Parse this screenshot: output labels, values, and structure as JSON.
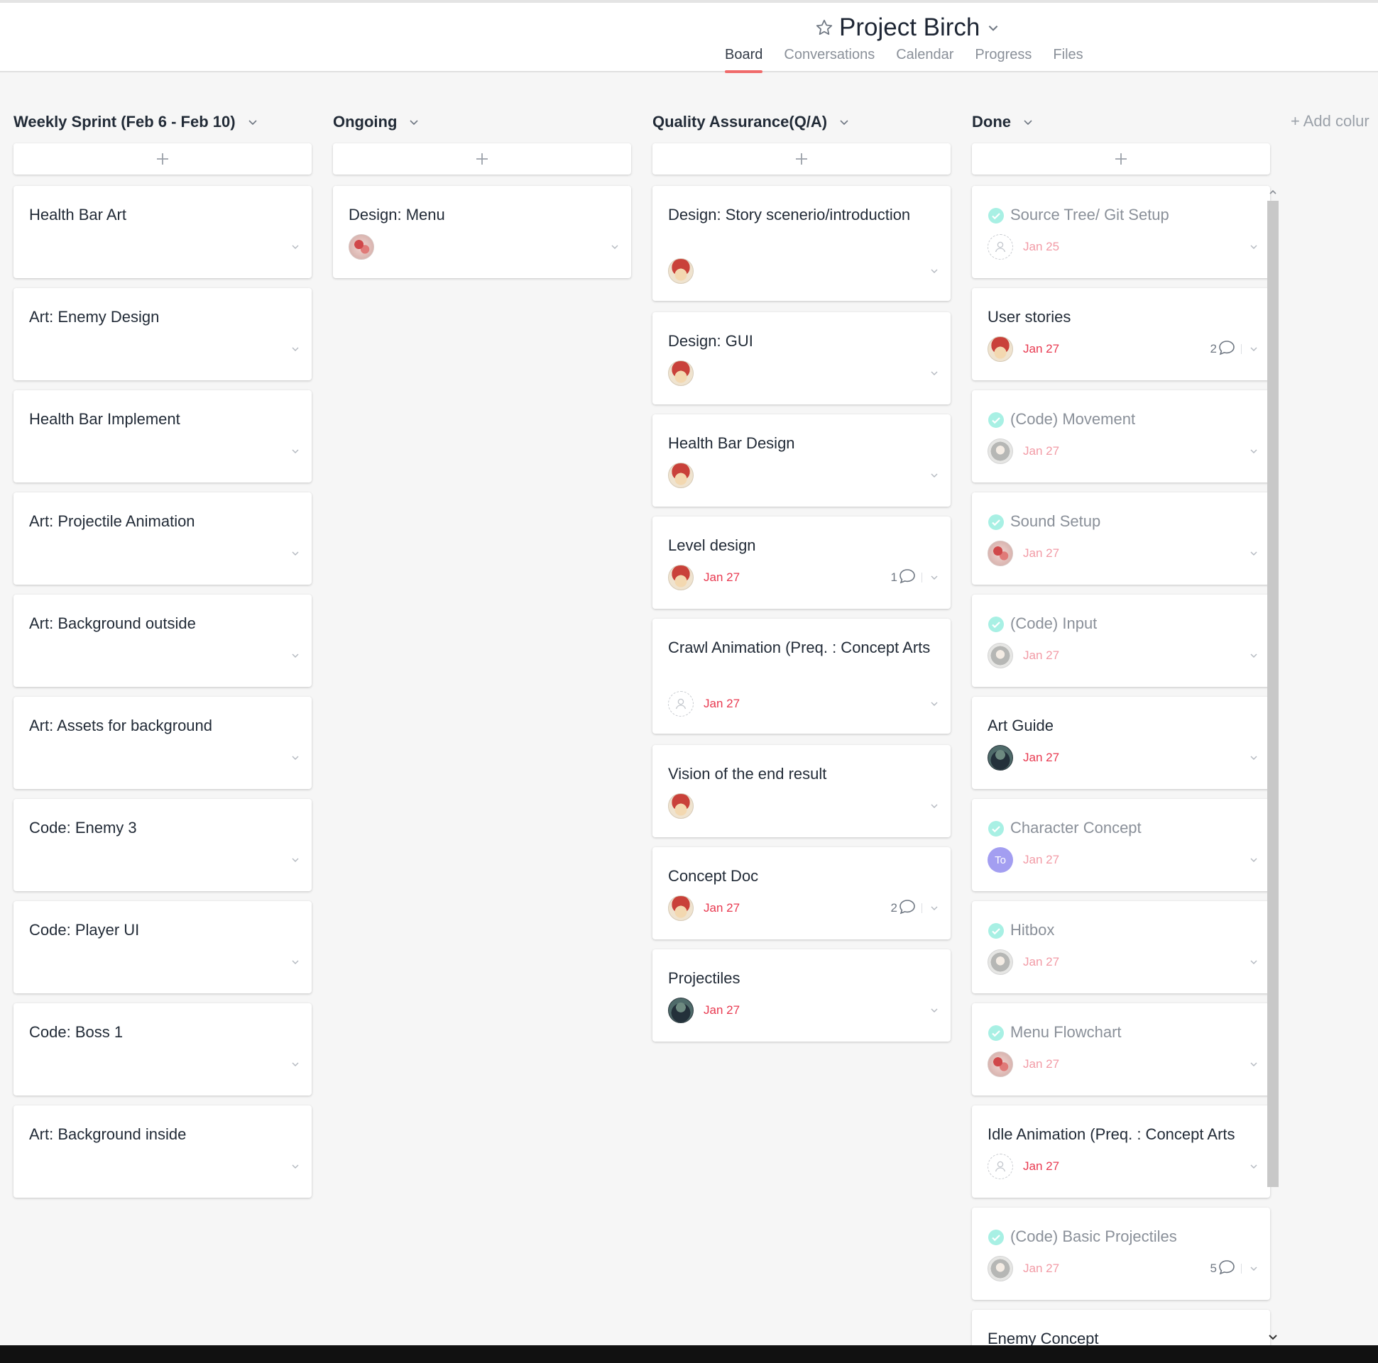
{
  "project": {
    "title": "Project Birch",
    "tabs": [
      "Board",
      "Conversations",
      "Calendar",
      "Progress",
      "Files"
    ],
    "active_tab": "Board",
    "accent_color": "#f06a6a"
  },
  "add_column_label": "+ Add colur",
  "columns": [
    {
      "title": "Weekly Sprint (Feb 6 - Feb 10)",
      "cards": [
        {
          "title": "Health Bar Art"
        },
        {
          "title": "Art: Enemy Design"
        },
        {
          "title": "Health Bar Implement"
        },
        {
          "title": "Art: Projectile Animation"
        },
        {
          "title": "Art: Background outside"
        },
        {
          "title": "Art: Assets for background"
        },
        {
          "title": "Code: Enemy 3"
        },
        {
          "title": "Code: Player UI"
        },
        {
          "title": "Code: Boss 1"
        },
        {
          "title": "Art: Background inside"
        }
      ]
    },
    {
      "title": "Ongoing",
      "cards": [
        {
          "title": "Design: Menu",
          "avatar": "coral"
        }
      ]
    },
    {
      "title": "Quality Assurance(Q/A)",
      "cards": [
        {
          "title": "Design: Story scenerio/introduction",
          "avatar": "fox"
        },
        {
          "title": "Design: GUI",
          "avatar": "fox"
        },
        {
          "title": "Health Bar Design",
          "avatar": "fox"
        },
        {
          "title": "Level design",
          "avatar": "fox",
          "due": "Jan 27",
          "comments": "1"
        },
        {
          "title": "Crawl Animation (Preq. : Concept Arts",
          "avatar": "empty",
          "due": "Jan 27"
        },
        {
          "title": "Vision of the end result",
          "avatar": "fox"
        },
        {
          "title": "Concept Doc",
          "avatar": "fox",
          "due": "Jan 27",
          "comments": "2"
        },
        {
          "title": "Projectiles",
          "avatar": "dark",
          "due": "Jan 27"
        }
      ]
    },
    {
      "title": "Done",
      "cards": [
        {
          "title": "Source Tree/ Git Setup",
          "avatar": "empty",
          "due": "Jan 25",
          "completed": true
        },
        {
          "title": "User stories",
          "avatar": "fox",
          "due": "Jan 27",
          "comments": "2"
        },
        {
          "title": "(Code) Movement",
          "avatar": "girl",
          "due": "Jan 27",
          "completed": true
        },
        {
          "title": "Sound Setup",
          "avatar": "coral",
          "due": "Jan 27",
          "completed": true
        },
        {
          "title": "(Code) Input",
          "avatar": "girl",
          "due": "Jan 27",
          "completed": true
        },
        {
          "title": "Art Guide",
          "avatar": "dark",
          "due": "Jan 27"
        },
        {
          "title": "Character Concept",
          "avatar": "to",
          "avatar_text": "To",
          "due": "Jan 27",
          "completed": true
        },
        {
          "title": "Hitbox",
          "avatar": "girl",
          "due": "Jan 27",
          "completed": true
        },
        {
          "title": "Menu Flowchart",
          "avatar": "coral",
          "due": "Jan 27",
          "completed": true
        },
        {
          "title": "Idle Animation (Preq. : Concept Arts",
          "avatar": "empty",
          "due": "Jan 27"
        },
        {
          "title": "(Code) Basic Projectiles",
          "avatar": "girl",
          "due": "Jan 27",
          "comments": "5",
          "completed": true
        },
        {
          "title": "Enemy Concept"
        }
      ]
    }
  ]
}
